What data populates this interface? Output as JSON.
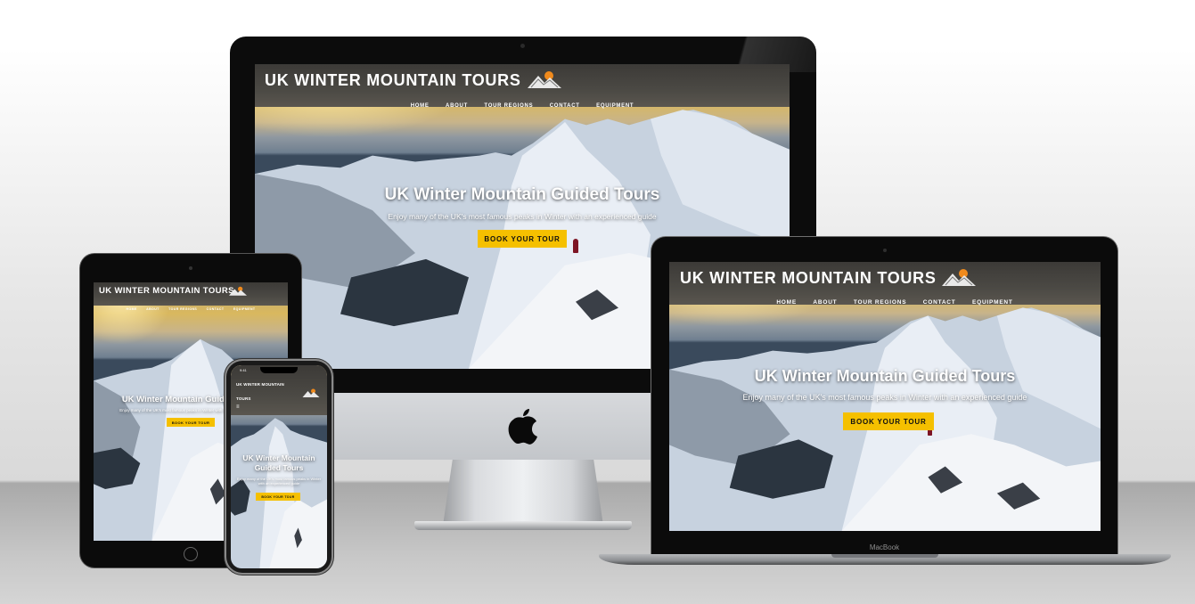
{
  "site": {
    "logo_text": "UK WINTER MOUNTAIN TOURS",
    "nav": [
      "HOME",
      "ABOUT",
      "TOUR REGIONS",
      "CONTACT",
      "EQUIPMENT"
    ],
    "hero_title": "UK Winter Mountain Guided Tours",
    "hero_subtitle": "Enjoy many of the UK's most famous peaks in Winter with an experienced guide",
    "cta_label": "BOOK YOUR TOUR"
  },
  "phone": {
    "status_time": "9:41",
    "logo_line": "UK WINTER MOUNTAIN",
    "logo_line2": "TOURS",
    "menu_icon": "hamburger-icon",
    "hero_title_line1": "UK Winter Mountain",
    "hero_title_line2": "Guided Tours",
    "hero_subtitle": "Enjoy many of the UK's most famous peaks in Winter with an experienced guide",
    "cta_label": "BOOK YOUR TOUR"
  },
  "devices": {
    "laptop_label": "MacBook",
    "imac_logo_icon": "apple-logo-icon"
  },
  "colors": {
    "cta": "#f5c000",
    "header": "#4b4944",
    "text": "#ffffff"
  }
}
